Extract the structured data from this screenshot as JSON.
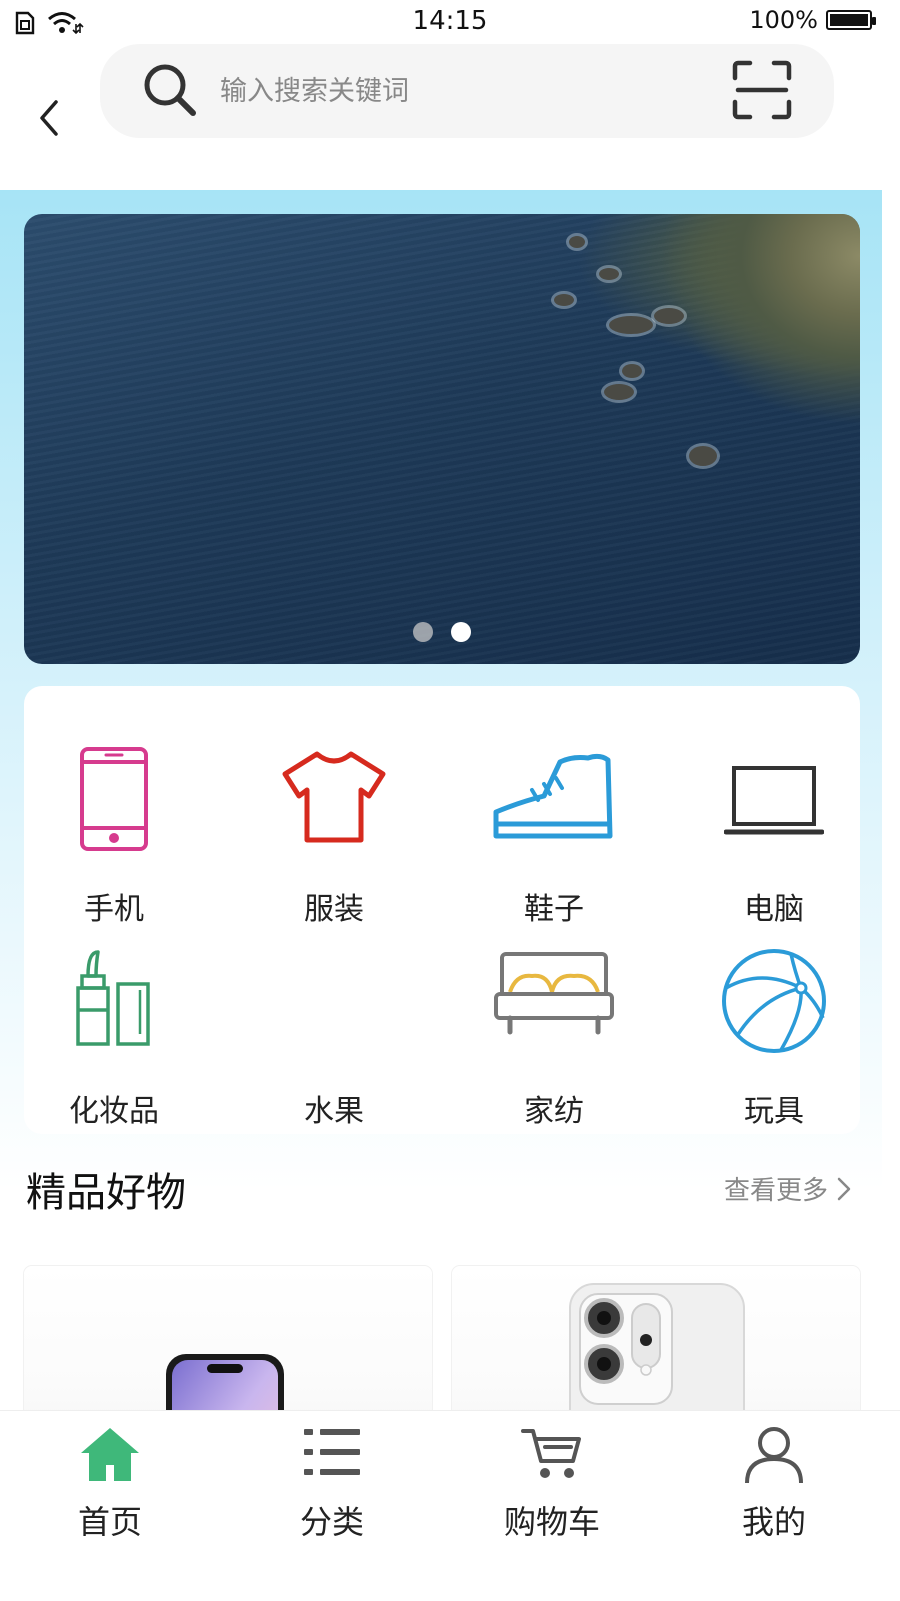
{
  "status_bar": {
    "time": "14:15",
    "battery": "100%",
    "battery_level": 1.0
  },
  "search": {
    "placeholder": "输入搜索关键词"
  },
  "banner": {
    "active_index": 1,
    "count": 2
  },
  "categories": [
    {
      "label": "手机",
      "icon": "smartphone-icon",
      "color": "#d63b8e"
    },
    {
      "label": "服装",
      "icon": "tshirt-icon",
      "color": "#d62a1e"
    },
    {
      "label": "鞋子",
      "icon": "shoe-icon",
      "color": "#2b9bd8"
    },
    {
      "label": "电脑",
      "icon": "laptop-icon",
      "color": "#333333"
    },
    {
      "label": "化妆品",
      "icon": "lipstick-icon",
      "color": "#3a9b6a"
    },
    {
      "label": "水果",
      "icon": "",
      "color": ""
    },
    {
      "label": "家纺",
      "icon": "bed-icon",
      "color": "#777777"
    },
    {
      "label": "玩具",
      "icon": "ball-icon",
      "color": "#2b9bd8"
    }
  ],
  "section": {
    "title": "精品好物",
    "more_label": "查看更多"
  },
  "tabbar": {
    "items": [
      {
        "label": "首页",
        "icon": "home-icon",
        "active": true
      },
      {
        "label": "分类",
        "icon": "list-icon",
        "active": false
      },
      {
        "label": "购物车",
        "icon": "cart-icon",
        "active": false
      },
      {
        "label": "我的",
        "icon": "user-icon",
        "active": false
      }
    ]
  },
  "colors": {
    "accent": "#3fb87a",
    "page_gradient_top": "#a7e4f6"
  }
}
